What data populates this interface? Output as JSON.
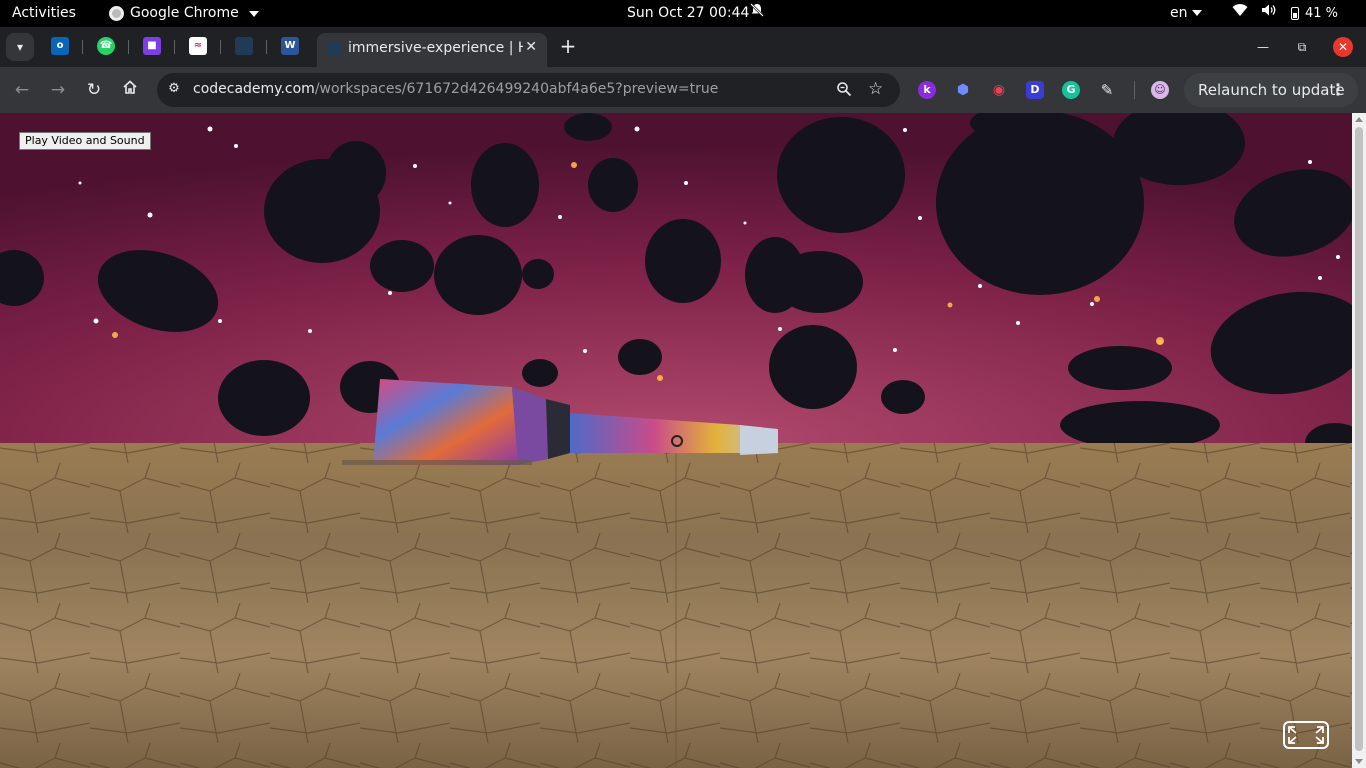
{
  "topbar": {
    "activities": "Activities",
    "app_name": "Google Chrome",
    "clock": "Sun Oct 27  00:44",
    "language": "en",
    "battery": "41 %"
  },
  "tabs": {
    "active_title": "immersive-experience | H",
    "close_glyph": "✕",
    "new_tab_glyph": "+"
  },
  "toolbar": {
    "url_host": "codecademy.com",
    "url_path": "/workspaces/671672d426499240abf4a6e5?preview=true",
    "relaunch_label": "Relaunch to update"
  },
  "page": {
    "play_button_label": "Play Video and Sound"
  },
  "colors": {
    "sky": "#7a1f45",
    "ground": "#9b7d52",
    "close_red": "#e8372c"
  },
  "icons": {
    "back": "arrow-left-icon",
    "forward": "arrow-right-icon",
    "reload": "reload-icon",
    "home": "home-icon",
    "site_info": "tune-icon",
    "zoom": "zoom-icon",
    "bookmark": "star-icon",
    "extensions": "puzzle-icon",
    "menu": "kebab-menu-icon",
    "fullscreen": "fullscreen-icon"
  }
}
